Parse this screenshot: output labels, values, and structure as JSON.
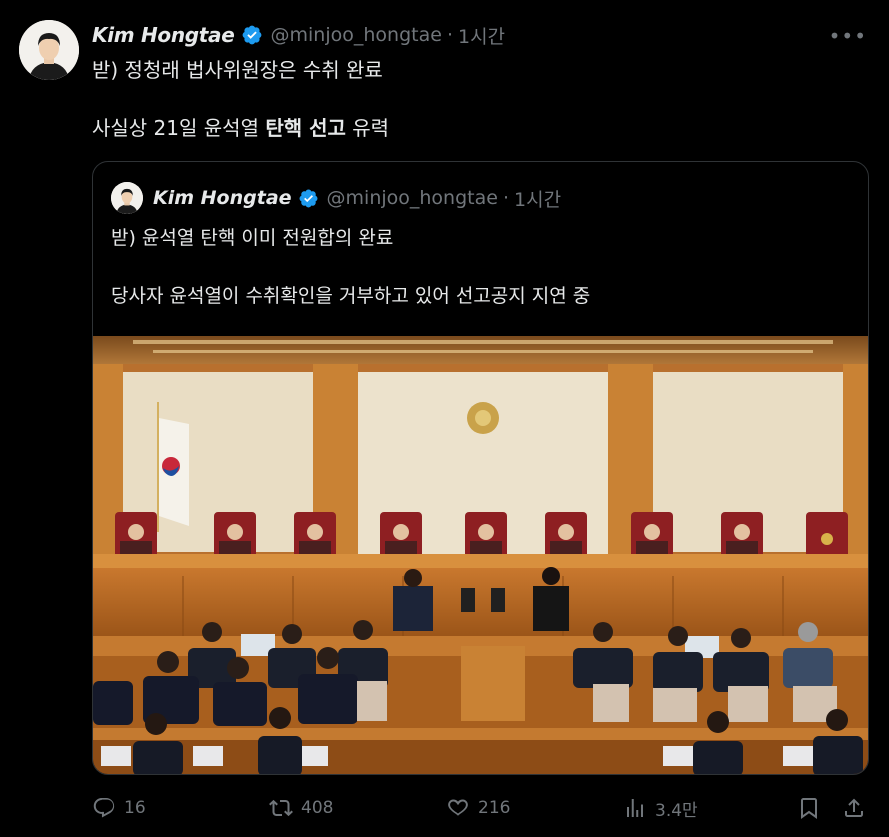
{
  "author": {
    "name": "Kim Hongtae",
    "handle": "@minjoo_hongtae",
    "separator": "·",
    "time": "1시간"
  },
  "tweet": {
    "line1": "받) 정청래 법사위원장은 수취 완료",
    "line2_prefix": "사실상 21일 윤석열 ",
    "line2_bold": "탄핵 선고",
    "line2_suffix": " 유력"
  },
  "quoted": {
    "name": "Kim Hongtae",
    "handle": "@minjoo_hongtae",
    "separator": "·",
    "time": "1시간",
    "line1": "받) 윤석열 탄핵 이미 전원합의 완료",
    "line2": "당사자 윤석열이 수취확인을 거부하고 있어 선고공지 지연 중"
  },
  "actions": {
    "reply_count": "16",
    "retweet_count": "408",
    "like_count": "216",
    "views_count": "3.4만"
  },
  "icons": {
    "more": "more-icon",
    "verified": "verified-badge-icon",
    "reply": "reply-icon",
    "retweet": "retweet-icon",
    "like": "heart-icon",
    "views": "views-chart-icon",
    "bookmark": "bookmark-icon",
    "share": "share-icon"
  },
  "colors": {
    "background": "#000000",
    "text": "#e7e9ea",
    "muted": "#71767b",
    "verified": "#1d9bf0",
    "border": "#2f3336"
  }
}
